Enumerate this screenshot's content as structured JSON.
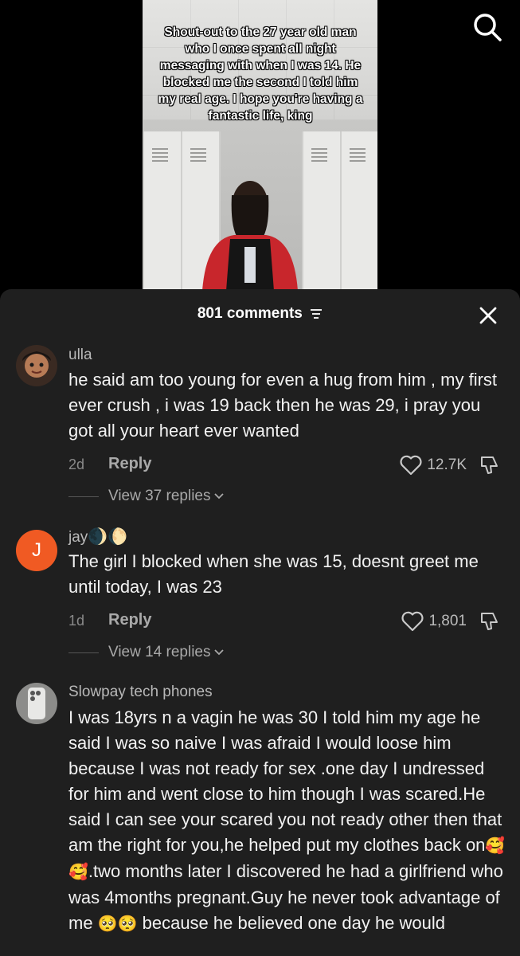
{
  "video": {
    "caption": "Shout-out to the 27 year old man who I once spent all night messaging with when I was 14. He blocked me the second I told him my real age. I hope you're having a fantastic life, king",
    "search_icon": "search-icon"
  },
  "sheet": {
    "comment_count": "801 comments",
    "filter_icon": "filter-icon",
    "close_icon": "close-icon"
  },
  "comments": [
    {
      "username": "ulla",
      "text": "he said am too young for even a hug from him , my first ever crush , i was 19 back then he was 29, i pray you got all your heart ever wanted",
      "time": "2d",
      "reply_label": "Reply",
      "likes": "12.7K",
      "view_replies": "View 37 replies"
    },
    {
      "username": "jay",
      "username_emoji": "🌒🌔",
      "avatar_letter": "J",
      "text": "The girl I blocked when she was 15, doesnt greet me until today, I was 23",
      "time": "1d",
      "reply_label": "Reply",
      "likes": "1,801",
      "view_replies": "View 14 replies"
    },
    {
      "username": "Slowpay tech phones",
      "text_part1": "I was 18yrs n a vagin he was 30 I told him my age he said I was so naive I was afraid I would loose him because I was not ready for sex .one day I undressed for him and went close to him though I was scared.He said I can see your scared you not ready other then that am the right for you,he helped put my clothes back on",
      "text_emoji1": "🥰🥰",
      "text_part2": ".two months later I discovered he had a girlfriend who was 4months pregnant.Guy he never took advantage of me ",
      "text_emoji2": "🥺🥺",
      "text_part3": " because he believed one day he would"
    }
  ],
  "colors": {
    "sheet_bg": "#1f1f1f",
    "avatar_orange": "#f05a23",
    "muted_text": "#a9a9a9"
  }
}
